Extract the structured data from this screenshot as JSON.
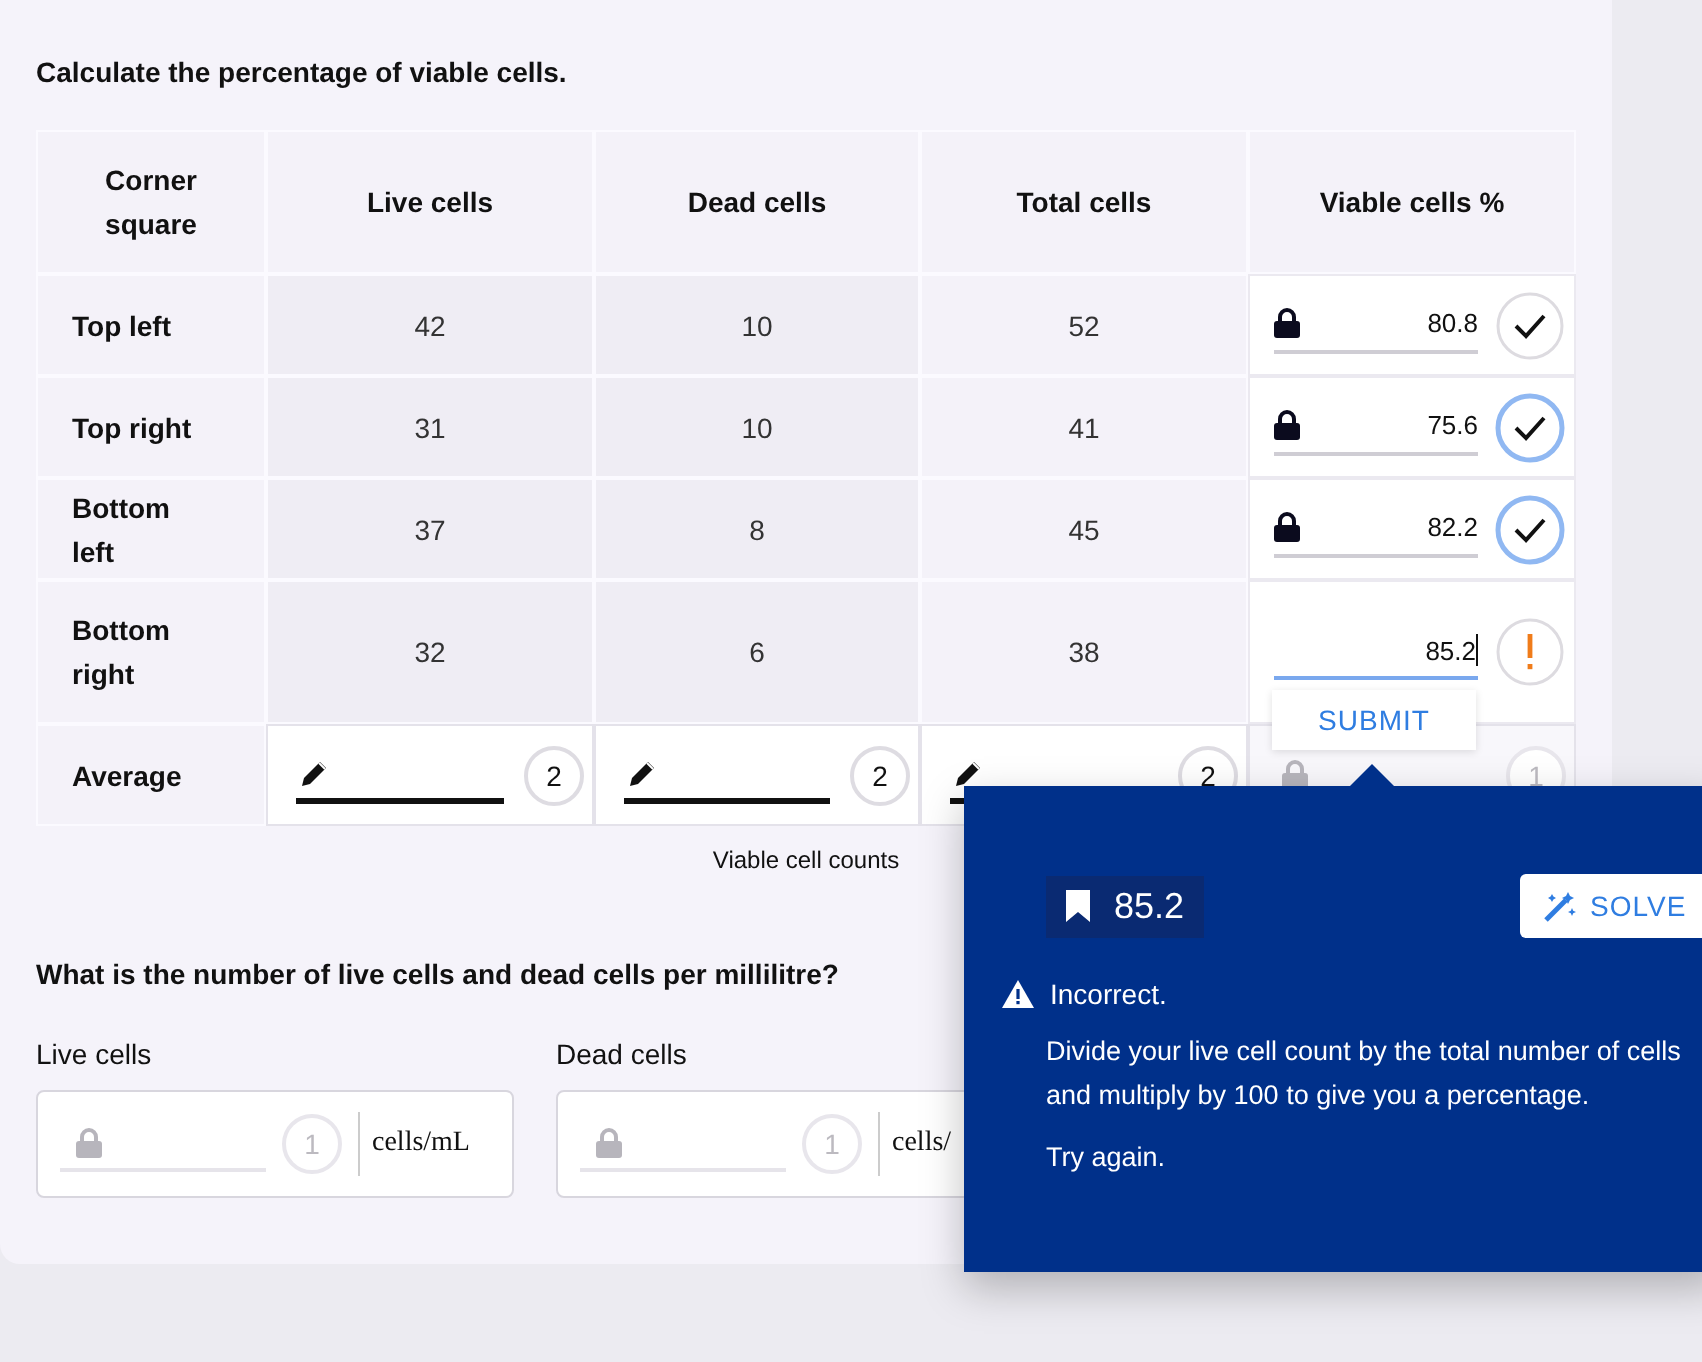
{
  "question": "Calculate the percentage of viable cells.",
  "table": {
    "columns": [
      "Corner square",
      "Live cells",
      "Dead cells",
      "Total cells",
      "Viable cells %"
    ],
    "rows": [
      {
        "corner": "Top left",
        "live": "42",
        "dead": "10",
        "total": "52",
        "viable": {
          "value": "80.8",
          "locked": true,
          "kind": "check",
          "highlighted": false
        }
      },
      {
        "corner": "Top right",
        "live": "31",
        "dead": "10",
        "total": "41",
        "viable": {
          "value": "75.6",
          "locked": true,
          "kind": "check",
          "highlighted": true
        }
      },
      {
        "corner": "Bottom left",
        "live": "37",
        "dead": "8",
        "total": "45",
        "viable": {
          "value": "82.2",
          "locked": true,
          "kind": "check",
          "highlighted": true
        }
      },
      {
        "corner": "Bottom right",
        "live": "32",
        "dead": "6",
        "total": "38",
        "viable": {
          "value": "85.2",
          "locked": false,
          "kind": "alert",
          "highlighted": false
        }
      }
    ],
    "average": {
      "label": "Average",
      "cells": [
        {
          "kind": "pencil",
          "attempts": "2",
          "disabled": false
        },
        {
          "kind": "pencil",
          "attempts": "2",
          "disabled": false
        },
        {
          "kind": "pencil",
          "attempts": "2",
          "disabled": false
        },
        {
          "kind": "locked",
          "attempts": "1",
          "disabled": true
        }
      ]
    },
    "caption": "Viable cell counts"
  },
  "submit_button": "SUBMIT",
  "feedback": {
    "answer": "85.2",
    "solve_button": "SOLVE",
    "status": "Incorrect.",
    "message": "Divide your live cell count by the total number of cells and multiply by 100 to give you a percentage.",
    "retry": "Try again."
  },
  "question_2": "What is the number of live cells and dead cells per millilitre?",
  "fields": [
    {
      "label": "Live cells",
      "attempts": "1",
      "unit": "cells/mL",
      "disabled": true
    },
    {
      "label": "Dead cells",
      "attempts": "1",
      "unit": "cells/",
      "disabled": true
    }
  ]
}
